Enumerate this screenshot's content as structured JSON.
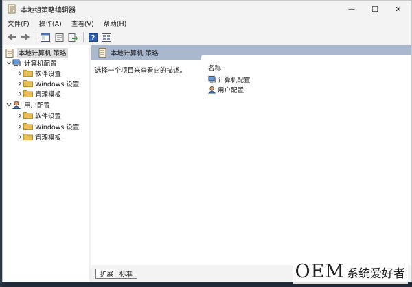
{
  "window": {
    "title": "本地组策略编辑器",
    "minimize_glyph": "—",
    "maximize_glyph": "☐",
    "close_glyph": "✕"
  },
  "menu": [
    "文件(F)",
    "操作(A)",
    "查看(V)",
    "帮助(H)"
  ],
  "toolbar": {
    "icons": [
      "back-icon",
      "forward-icon",
      "show-tree-icon",
      "properties-icon",
      "export-list-icon",
      "help-icon",
      "view-icon"
    ]
  },
  "tree": {
    "root": "本地计算机 策略",
    "computer": {
      "label": "计算机配置",
      "children": [
        "软件设置",
        "Windows 设置",
        "管理模板"
      ]
    },
    "user": {
      "label": "用户配置",
      "children": [
        "软件设置",
        "Windows 设置",
        "管理模板"
      ]
    }
  },
  "content": {
    "header": "本地计算机 策略",
    "description": "选择一个项目来查看它的描述。",
    "column_name": "名称",
    "items": [
      "计算机配置",
      "用户配置"
    ]
  },
  "tabs": [
    "扩展",
    "标准"
  ],
  "watermark": {
    "big": "OEM",
    "small": "系统爱好者"
  },
  "colors": {
    "header_bg": "#a9b8cf",
    "folder": "#e8c05a",
    "selected_bg": "#dcdcdc"
  }
}
